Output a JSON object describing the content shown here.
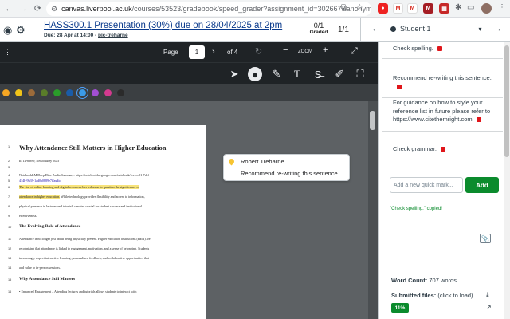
{
  "browser": {
    "url_host": "canvas.liverpool.ac.uk",
    "url_path": "/courses/53523/gradebook/speed_grader?assignment_id=302667&anonymo..."
  },
  "header": {
    "title": "HASS300.1 Presentation (30%) due on 28/04/2025 at 2pm",
    "due_prefix": "Due: 28 Apr at 14:00 - ",
    "due_link": "pic-treharne",
    "graded_count": "0/1",
    "graded_label": "Graded",
    "position": "1/1",
    "student_name": "Student 1"
  },
  "viewer": {
    "page_label": "Page",
    "page_value": "1",
    "page_total": "of 4",
    "zoom_label": "ZOOM"
  },
  "colors": [
    "#f5a623",
    "#f0c419",
    "#9b6b3a",
    "#5a7d2a",
    "#2a9d2a",
    "#1a5ca8",
    "#3b9be8",
    "#a24fd3",
    "#d33a8f",
    "#2b2b2b"
  ],
  "colors_selected": 6,
  "document": {
    "heading": "Why Attendance Still Matters in Higher Education",
    "lines": [
      {
        "n": "2",
        "text": "R. Treharne, 4th January 2025",
        "cls": "italic"
      },
      {
        "n": "3",
        "text": "",
        "cls": ""
      },
      {
        "n": "4",
        "text": "NotebookLM Deep Dive Audio Summary: https://notebooklm.google.com/notebook/fceecc91-7dcf-",
        "cls": ""
      },
      {
        "n": "5",
        "text": "414b-9b39-1ad0a0889e7f/audio",
        "cls": "link"
      },
      {
        "n": "6",
        "text": "The rise of online learning and digital resources has led some to question the significance of",
        "cls": "hl"
      },
      {
        "n": "7",
        "text": "attendance in higher education. While technology provides flexibility and access to information,",
        "cls": "hlpart"
      },
      {
        "n": "8",
        "text": "physical presence in lectures and tutorials remains crucial for student success and institutional",
        "cls": ""
      },
      {
        "n": "9",
        "text": "effectiveness.",
        "cls": ""
      },
      {
        "n": "10",
        "text": "The Evolving Role of Attendance",
        "cls": "bold"
      },
      {
        "n": "11",
        "text": "Attendance is no longer just about being physically present. Higher education institutions (HEIs) are",
        "cls": ""
      },
      {
        "n": "12",
        "text": "recognising that attendance is linked to engagement, motivation, and a sense of belonging. Students",
        "cls": ""
      },
      {
        "n": "13",
        "text": "increasingly expect interactive learning, personalised feedback, and collaborative opportunities that",
        "cls": ""
      },
      {
        "n": "14",
        "text": "add value to in-person sessions.",
        "cls": ""
      },
      {
        "n": "15",
        "text": "Why Attendance Still Matters",
        "cls": "bold"
      },
      {
        "n": "16",
        "text": "•  Enhanced Engagement – Attending lectures and tutorials allows students to interact with",
        "cls": ""
      }
    ],
    "highlight_part": "attendance in higher education.",
    "highlight_rest": " While technology provides flexibility and access to information,"
  },
  "comment_popup": {
    "author": "Robert Treharne",
    "body": "Recommend re-writing this sentence."
  },
  "panel": {
    "quick_comments": [
      "Check spelling.",
      "Recommend re-writing this sentence.",
      "For guidance on how to style your reference list in future please refer to https://www.citethemright.com",
      "Check grammar."
    ],
    "input_placeholder": "Add a new quick mark...",
    "add_label": "Add",
    "copied_msg": "\"Check spelling.\" copied!",
    "word_count_label": "Word Count:",
    "word_count_value": "707 words",
    "submitted_label": "Submitted files:",
    "submitted_hint": "(click to load)",
    "similarity": "11%"
  }
}
